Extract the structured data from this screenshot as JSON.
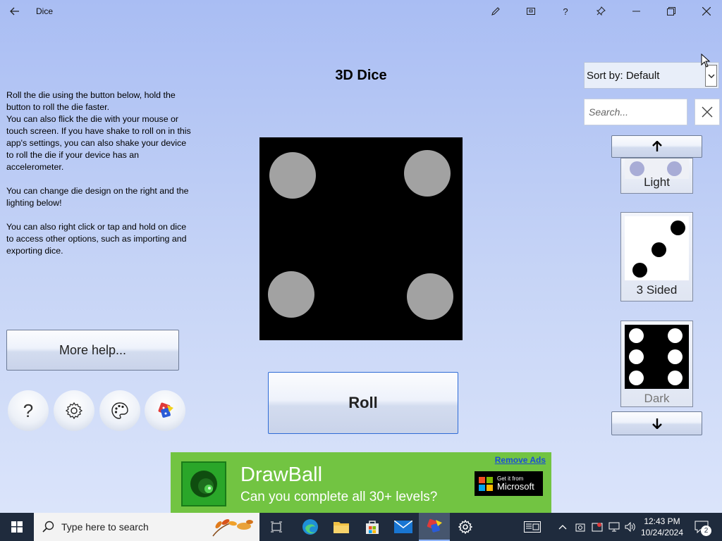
{
  "titlebar": {
    "title": "Dice",
    "icons": [
      "back-arrow-icon",
      "pen-icon",
      "compact-overlay-icon",
      "help-icon",
      "pin-icon",
      "minimize-icon",
      "restore-icon",
      "close-icon"
    ]
  },
  "help_text": "Roll the die using the button below, hold the button to roll the die faster.\nYou can also flick the die with your mouse or touch screen. If you have shake to roll on in this app's settings, you can also shake your device to roll the die if your device has an accelerometer.\n\nYou can change die design on the right and the lighting  below!\n\nYou can also right click or tap and hold on dice to access other options, such as importing and exporting dice.",
  "more_help_label": "More help...",
  "round_buttons": [
    "help-icon",
    "settings-gear-icon",
    "palette-icon",
    "lighting-icon"
  ],
  "round_help_glyph": "?",
  "main_title": "3D Dice",
  "die": {
    "face_value": 4,
    "face_color": "#000000",
    "pip_color": "#a2a2a2"
  },
  "roll_label": "Roll",
  "sidebar": {
    "sort_label": "Sort by: Default",
    "search_placeholder": "Search...",
    "dice_list": [
      {
        "label": "Light",
        "partial": true
      },
      {
        "label": "3 Sided",
        "partial": false
      },
      {
        "label": "Dark",
        "partial": true
      }
    ]
  },
  "ad": {
    "remove_label": "Remove Ads",
    "title": "DrawBall",
    "subtitle": "Can you complete all 30+ levels?",
    "store_small": "Get it from",
    "store_big": "Microsoft",
    "background": "#72c442"
  },
  "taskbar": {
    "search_placeholder": "Type here to search",
    "time": "12:43 PM",
    "date": "10/24/2024",
    "notification_count": "2",
    "pinned": [
      "task-view-icon",
      "edge-icon",
      "file-explorer-icon",
      "store-icon",
      "mail-icon",
      "dice-app-icon",
      "settings-icon"
    ]
  }
}
